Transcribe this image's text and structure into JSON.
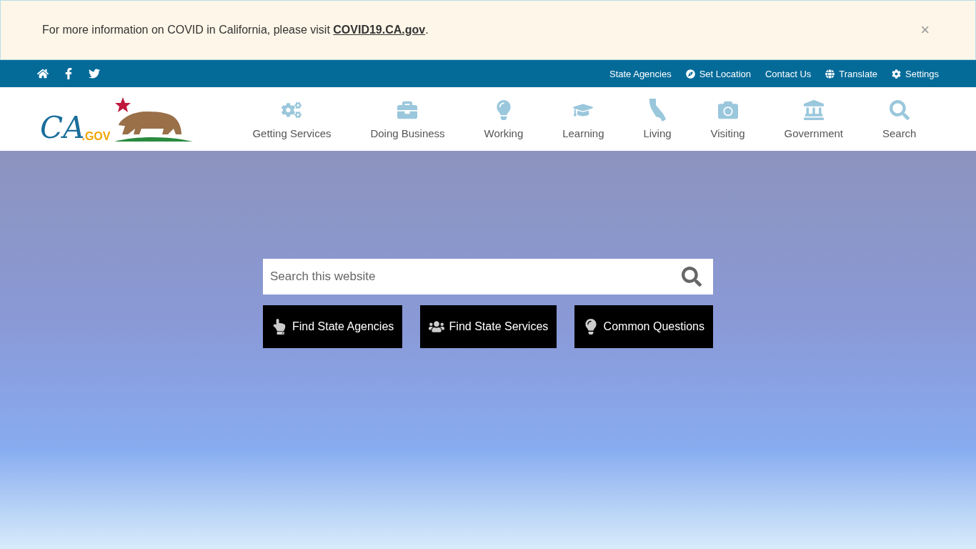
{
  "alert_banner": {
    "text": "For more information on COVID in California, please visit ",
    "link": "COVID19.CA.gov",
    "text_end": ".",
    "close": "×"
  },
  "utility_bar": {
    "social": [
      {
        "kind": "home"
      },
      {
        "kind": "facebook"
      },
      {
        "kind": "twitter"
      }
    ],
    "links": [
      {
        "label": "State Agencies",
        "kind": "none"
      },
      {
        "label": "Set Location",
        "kind": "location"
      },
      {
        "label": "Contact Us",
        "kind": "none"
      },
      {
        "label": "Translate",
        "kind": "globe"
      },
      {
        "label": "Settings",
        "kind": "gear"
      }
    ]
  },
  "logo": {
    "text": "CA",
    "suffix": ".GOV"
  },
  "main_nav": [
    {
      "label": "Getting Services",
      "kind": "gears"
    },
    {
      "label": "Doing Business",
      "kind": "briefcase"
    },
    {
      "label": "Working",
      "kind": "bulb"
    },
    {
      "label": "Learning",
      "kind": "cap"
    },
    {
      "label": "Living",
      "kind": "state"
    },
    {
      "label": "Visiting",
      "kind": "camera"
    },
    {
      "label": "Government",
      "kind": "capitol"
    },
    {
      "label": "Search",
      "kind": "search"
    }
  ],
  "hero": {
    "search": {
      "placeholder": "Search this website"
    },
    "buttons": [
      {
        "label": "Find State Agencies",
        "kind": "pointer"
      },
      {
        "label": "Find State Services",
        "kind": "people"
      },
      {
        "label": "Common Questions",
        "kind": "bulb"
      }
    ]
  }
}
